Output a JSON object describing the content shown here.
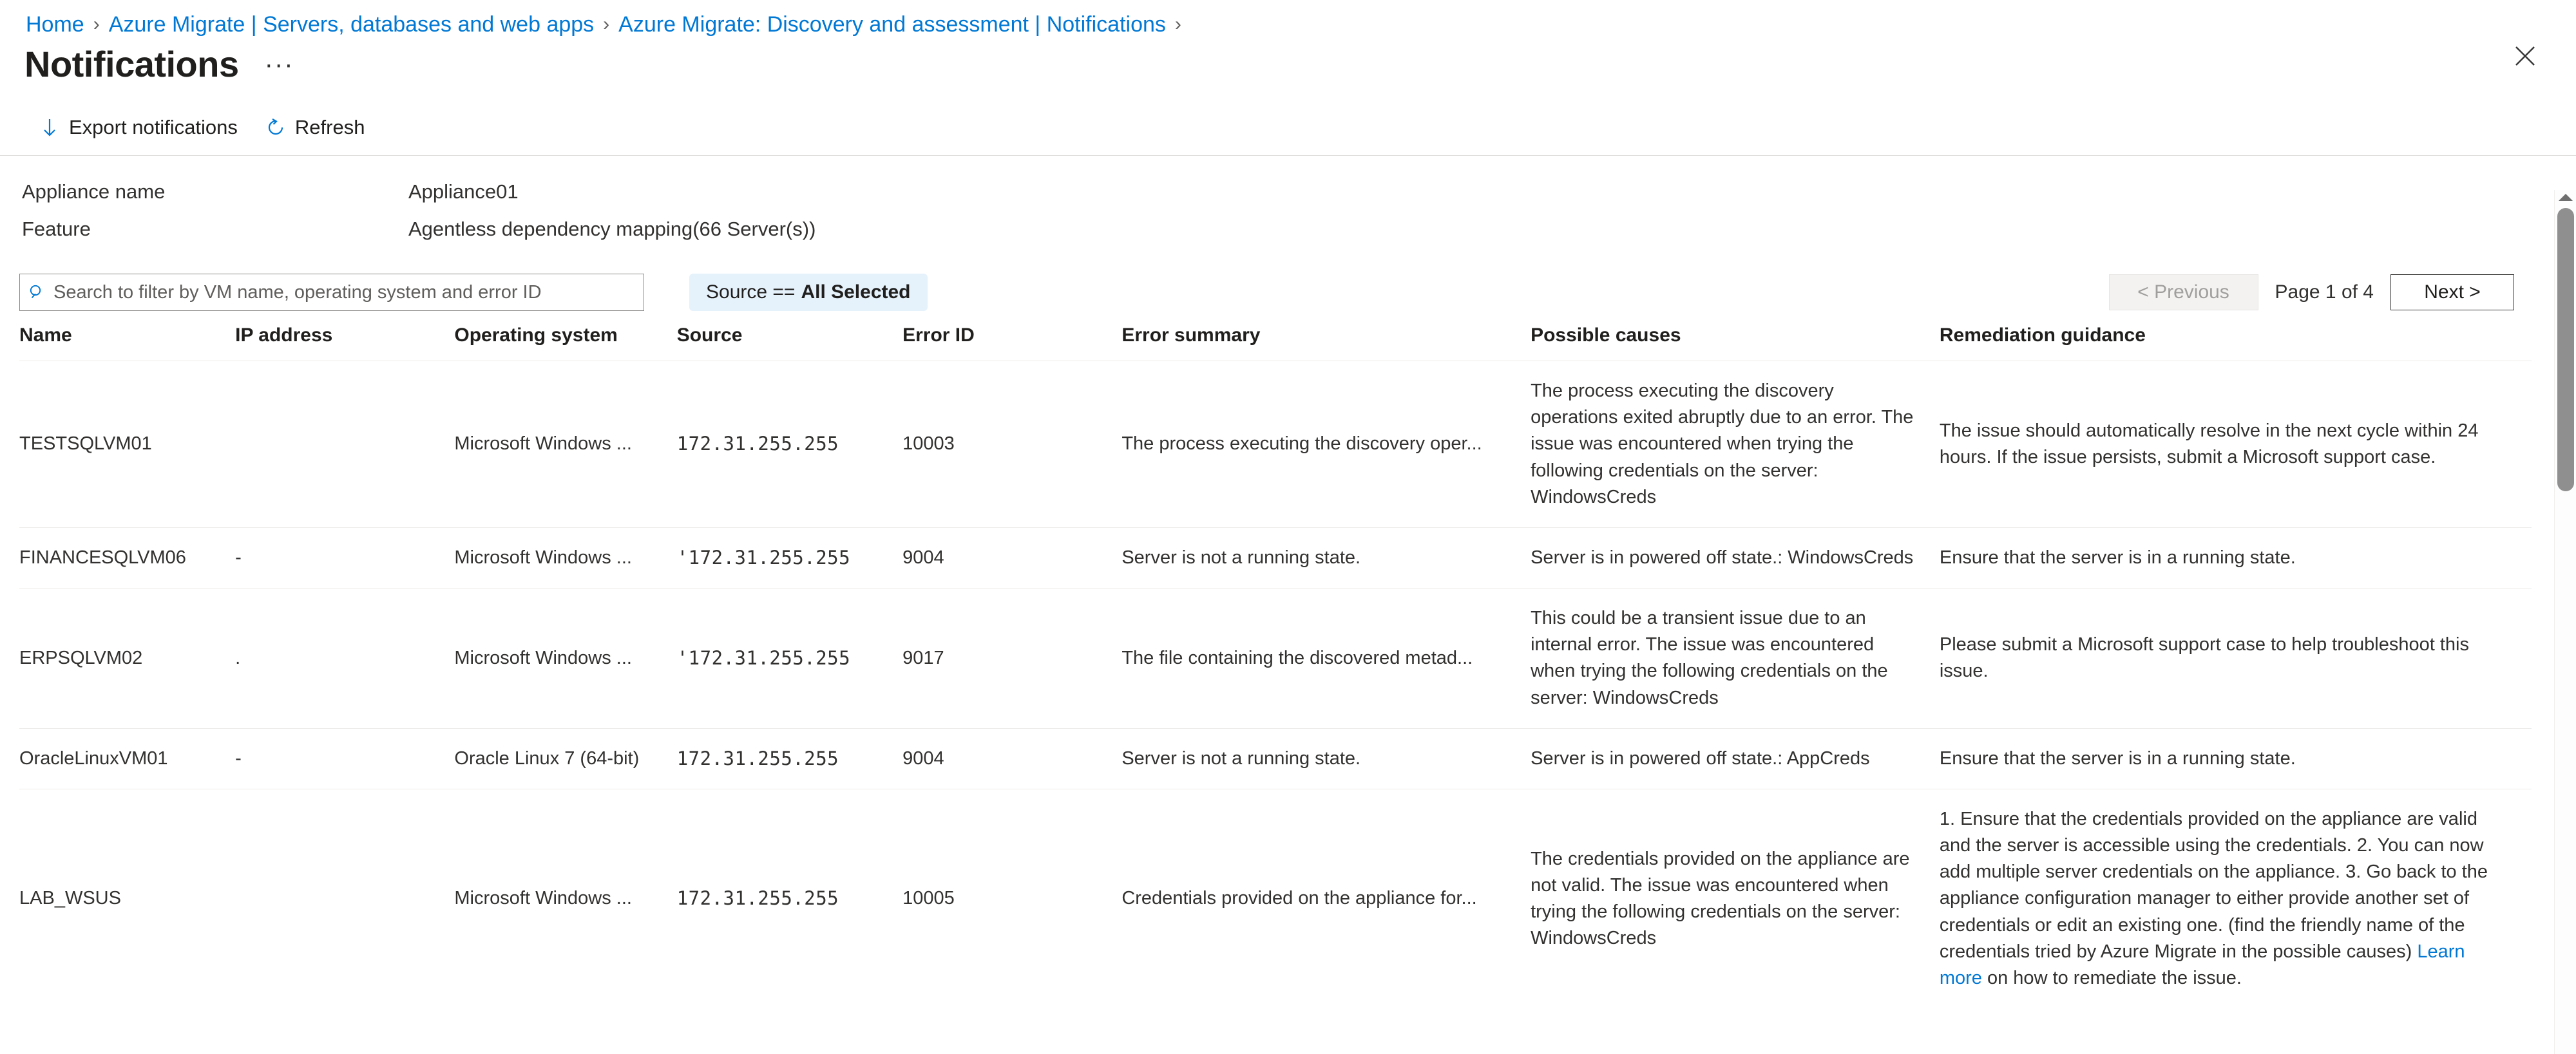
{
  "breadcrumb": {
    "items": [
      {
        "label": "Home"
      },
      {
        "label": "Azure Migrate | Servers, databases and web apps"
      },
      {
        "label": "Azure Migrate: Discovery and assessment | Notifications"
      }
    ],
    "separator": "›"
  },
  "header": {
    "title": "Notifications",
    "more_label": "···",
    "close_icon": "close-icon"
  },
  "toolbar": {
    "export_label": "Export notifications",
    "export_icon": "download-arrow-icon",
    "refresh_label": "Refresh",
    "refresh_icon": "refresh-icon"
  },
  "summary": {
    "appliance_name_label": "Appliance name",
    "appliance_name_value": "Appliance01",
    "feature_label": "Feature",
    "feature_value": "Agentless dependency mapping(66 Server(s))"
  },
  "filters": {
    "search_placeholder": "Search to filter by VM name, operating system and error ID",
    "search_value": "",
    "search_icon": "search-icon",
    "source_filter_label": "Source  ==",
    "source_filter_value": "All Selected"
  },
  "pagination": {
    "previous_label": "< Previous",
    "previous_disabled": true,
    "page_label": "Page 1 of 4",
    "next_label": "Next >"
  },
  "table": {
    "columns": [
      "Name",
      "IP address",
      "Operating system",
      "Source",
      "Error ID",
      "Error summary",
      "Possible causes",
      "Remediation guidance"
    ],
    "rows": [
      {
        "name": "TESTSQLVM01",
        "ip": "",
        "os": "Microsoft Windows ...",
        "source": "172.31.255.255",
        "error_id": "10003",
        "error_summary": "The process executing the discovery oper...",
        "possible_causes": "The process executing the discovery operations exited abruptly due to an error. The issue was encountered when trying the following credentials on the server: WindowsCreds",
        "remediation": "The issue should automatically resolve in the next cycle within 24 hours. If the issue persists, submit a Microsoft support case.",
        "remediation_link": "",
        "remediation_link_tail": ""
      },
      {
        "name": "FINANCESQLVM06",
        "ip": "-",
        "os": "Microsoft Windows ...",
        "source": "'172.31.255.255",
        "error_id": "9004",
        "error_summary": "Server is not a running state.",
        "possible_causes": "Server is in powered off state.: WindowsCreds",
        "remediation": "Ensure that the server is in a running state.",
        "remediation_link": "",
        "remediation_link_tail": ""
      },
      {
        "name": "ERPSQLVM02",
        "ip": ".",
        "os": "Microsoft Windows ...",
        "source": "'172.31.255.255",
        "error_id": "9017",
        "error_summary": "The file containing the discovered metad...",
        "possible_causes": "This could be a transient issue due to an internal error. The issue was encountered when trying the following credentials on the server: WindowsCreds",
        "remediation": "Please submit a Microsoft support case to help troubleshoot this issue.",
        "remediation_link": "",
        "remediation_link_tail": ""
      },
      {
        "name": "OracleLinuxVM01",
        "ip": "-",
        "os": "Oracle Linux 7 (64-bit)",
        "source": "172.31.255.255",
        "error_id": "9004",
        "error_summary": "Server is not a running state.",
        "possible_causes": "Server is in powered off state.: AppCreds",
        "remediation": "Ensure that the server is in a running state.",
        "remediation_link": "",
        "remediation_link_tail": ""
      },
      {
        "name": "LAB_WSUS",
        "ip": "",
        "os": "Microsoft Windows ...",
        "source": "172.31.255.255",
        "error_id": "10005",
        "error_summary": "Credentials provided on the appliance for...",
        "possible_causes": "The credentials provided on the appliance are not valid. The issue was encountered when trying the following credentials on the server: WindowsCreds",
        "remediation": "1. Ensure that the credentials provided on the appliance are valid and the server is accessible using the credentials.\n2. You can now add multiple server credentials on the appliance.\n3. Go back to the appliance configuration manager to either provide another set of credentials or edit an existing one. (find the friendly name of the credentials tried by Azure Migrate in the possible causes)\n",
        "remediation_link": "Learn more",
        "remediation_link_tail": " on how to remediate the issue."
      }
    ]
  },
  "colors": {
    "accent": "#0078d4",
    "pill_background": "#e5f1fb",
    "border": "#e1dfdd",
    "row_border": "#edebe9",
    "text": "#323130"
  }
}
